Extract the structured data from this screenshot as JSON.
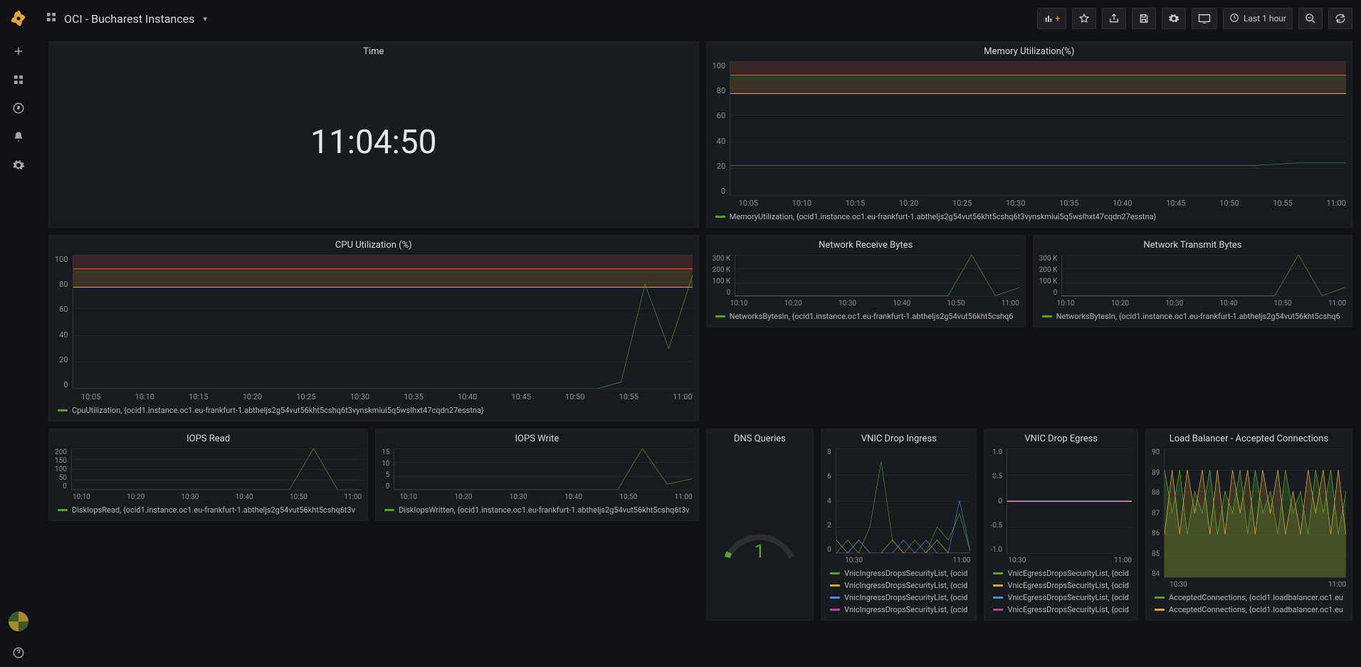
{
  "header": {
    "title": "OCI - Bucharest Instances",
    "time_range_label": "Last 1 hour"
  },
  "leftnav": {
    "items": [
      "create",
      "dashboards",
      "explore",
      "alerting",
      "configuration"
    ],
    "bottom": [
      "avatar",
      "help"
    ]
  },
  "topbar_icons": [
    "add-panel",
    "star",
    "share",
    "save",
    "settings",
    "cycle-view",
    "time-range",
    "zoom-out",
    "refresh"
  ],
  "panels": {
    "time": {
      "title": "Time",
      "value": "11:04:50"
    },
    "memory": {
      "title": "Memory Utilization(%)",
      "chart_data": {
        "type": "line",
        "ylim": [
          0,
          100
        ],
        "yticks": [
          0,
          20,
          40,
          60,
          80,
          100
        ],
        "xticks": [
          "10:05",
          "10:10",
          "10:15",
          "10:20",
          "10:25",
          "10:30",
          "10:35",
          "10:40",
          "10:45",
          "10:50",
          "10:55",
          "11:00"
        ],
        "thresholds": [
          {
            "value": 90,
            "color": "red",
            "fill_above": true
          },
          {
            "value": 76,
            "color": "orange",
            "fill_to_next": true
          }
        ],
        "series": [
          {
            "name": "MemoryUtilization, {ocid1.instance.oc1.eu-frankfurt-1.abtheljs2g54vut56kht5cshq6t3vynskmiui5q5wslhxt47cqdn27esstna}",
            "color": "#5aa02c",
            "values": [
              22,
              22,
              22,
              22,
              22,
              22,
              22,
              22,
              22,
              22,
              22,
              22,
              22,
              22,
              22,
              22,
              22,
              22,
              22,
              22,
              22,
              22,
              22,
              23,
              24,
              24,
              24
            ]
          }
        ]
      }
    },
    "cpu": {
      "title": "CPU Utilization (%)",
      "chart_data": {
        "type": "line",
        "ylim": [
          0,
          100
        ],
        "yticks": [
          0,
          20,
          40,
          60,
          80,
          100
        ],
        "xticks": [
          "10:05",
          "10:10",
          "10:15",
          "10:20",
          "10:25",
          "10:30",
          "10:35",
          "10:40",
          "10:45",
          "10:50",
          "10:55",
          "11:00"
        ],
        "thresholds": [
          {
            "value": 90,
            "color": "red",
            "fill_above": true
          },
          {
            "value": 76,
            "color": "orange",
            "fill_to_next": true
          }
        ],
        "series": [
          {
            "name": "CpuUtilization, {ocid1.instance.oc1.eu-frankfurt-1.abtheljs2g54vut56kht5cshq6t3vynskmiui5q5wslhxt47cqdn27esstna}",
            "color": "#5aa02c",
            "values": [
              0,
              0,
              0,
              0,
              0,
              0,
              0,
              0,
              0,
              0,
              0,
              0,
              0,
              0,
              0,
              0,
              0,
              0,
              0,
              0,
              0,
              0,
              0,
              5,
              78,
              30,
              85
            ]
          }
        ]
      }
    },
    "netrx": {
      "title": "Network Receive Bytes",
      "chart_data": {
        "type": "line",
        "ylim": [
          0,
          300000
        ],
        "yticks": [
          0,
          100000,
          200000,
          300000
        ],
        "ytick_labels": [
          "0",
          "100 K",
          "200 K",
          "300 K"
        ],
        "xticks": [
          "10:10",
          "10:20",
          "10:30",
          "10:40",
          "10:50",
          "11:00"
        ],
        "series": [
          {
            "name": "NetworksBytesIn, {ocid1.instance.oc1.eu-frankfurt-1.abtheljs2g54vut56kht5cshq6",
            "color": "#5aa02c",
            "values": [
              3000,
              3000,
              3000,
              3000,
              3000,
              3000,
              3000,
              3000,
              3000,
              3000,
              300000,
              3000,
              60000
            ]
          }
        ]
      }
    },
    "nettx": {
      "title": "Network Transmit Bytes",
      "chart_data": {
        "type": "line",
        "ylim": [
          0,
          300000
        ],
        "yticks": [
          0,
          100000,
          200000,
          300000
        ],
        "ytick_labels": [
          "0",
          "100 K",
          "200 K",
          "300 K"
        ],
        "xticks": [
          "10:10",
          "10:20",
          "10:30",
          "10:40",
          "10:50",
          "11:00"
        ],
        "series": [
          {
            "name": "NetworksBytesIn, {ocid1.instance.oc1.eu-frankfurt-1.abtheljs2g54vut56kht5cshq6",
            "color": "#5aa02c",
            "values": [
              3000,
              3000,
              3000,
              3000,
              3000,
              3000,
              3000,
              3000,
              3000,
              3000,
              300000,
              3000,
              65000
            ]
          }
        ]
      }
    },
    "iops_read": {
      "title": "IOPS Read",
      "chart_data": {
        "type": "line",
        "ylim": [
          0,
          200
        ],
        "yticks": [
          0,
          50,
          100,
          150,
          200
        ],
        "xticks": [
          "10:10",
          "10:20",
          "10:30",
          "10:40",
          "10:50",
          "11:00"
        ],
        "series": [
          {
            "name": "DiskIopsRead, {ocid1.instance.oc1.eu-frankfurt-1.abtheljs2g54vut56kht5cshq6t3v",
            "color": "#5aa02c",
            "values": [
              0,
              0,
              0,
              0,
              0,
              0,
              0,
              0,
              0,
              0,
              200,
              0,
              0
            ]
          }
        ]
      }
    },
    "iops_write": {
      "title": "IOPS Write",
      "chart_data": {
        "type": "line",
        "ylim": [
          0,
          15
        ],
        "yticks": [
          0,
          5,
          10,
          15
        ],
        "xticks": [
          "10:10",
          "10:20",
          "10:30",
          "10:40",
          "10:50",
          "11:00"
        ],
        "series": [
          {
            "name": "DiskIopsWritten, {ocid1.instance.oc1.eu-frankfurt-1.abtheljs2g54vut56kht5cshq6t3v",
            "color": "#5aa02c",
            "values": [
              0,
              0,
              0,
              0,
              0,
              0,
              0,
              0,
              0,
              0,
              15,
              2,
              4
            ]
          }
        ]
      }
    },
    "dns": {
      "title": "DNS Queries",
      "gauge": {
        "value": 1,
        "min": 0,
        "max": 100,
        "color": "#5aa02c"
      }
    },
    "vnic_in": {
      "title": "VNIC Drop Ingress",
      "chart_data": {
        "type": "line",
        "ylim": [
          0,
          8
        ],
        "yticks": [
          0,
          2,
          4,
          6,
          8
        ],
        "xticks": [
          "10:30",
          "11:00"
        ],
        "series": [
          {
            "name": "VnicIngressDropsSecurityList, {ocid",
            "color": "#5aa02c",
            "values": [
              0,
              1,
              0,
              2,
              7,
              1,
              0,
              1,
              0,
              2,
              1,
              3,
              0
            ]
          },
          {
            "name": "VnicIngressDropsSecurityList, {ocid",
            "color": "#d6a63c",
            "values": [
              1,
              0,
              1,
              0,
              0,
              1,
              0,
              0,
              0,
              1,
              0,
              0,
              0
            ]
          },
          {
            "name": "VnicIngressDropsSecurityList, {ocid",
            "color": "#4a90d9",
            "values": [
              0,
              0,
              1,
              0,
              0,
              0,
              1,
              0,
              1,
              0,
              0,
              4,
              0
            ]
          },
          {
            "name": "VnicIngressDropsSecurityList, {ocid",
            "color": "#b24a8e",
            "values": [
              0,
              0,
              0,
              0,
              0,
              0,
              0,
              0,
              0,
              0,
              0,
              0,
              0
            ]
          }
        ]
      }
    },
    "vnic_eg": {
      "title": "VNIC Drop Egress",
      "chart_data": {
        "type": "line",
        "ylim": [
          -1,
          1
        ],
        "yticks": [
          -1,
          -0.5,
          0,
          0.5,
          1
        ],
        "ytick_labels": [
          "-1.0",
          "-0.5",
          "0",
          "0.5",
          "1.0"
        ],
        "xticks": [
          "10:30",
          "11:00"
        ],
        "thresholds": [
          {
            "value": 0,
            "color": "orange",
            "fill_to_next": false
          }
        ],
        "series": [
          {
            "name": "VnicEgressDropsSecurityList, {ocid",
            "color": "#5aa02c",
            "values": [
              0,
              0,
              0,
              0,
              0,
              0,
              0,
              0,
              0,
              0,
              0,
              0,
              0
            ]
          },
          {
            "name": "VnicEgressDropsSecurityList, {ocid",
            "color": "#d6a63c",
            "values": [
              0,
              0,
              0,
              0,
              0,
              0,
              0,
              0,
              0,
              0,
              0,
              0,
              0
            ]
          },
          {
            "name": "VnicEgressDropsSecurityList, {ocid",
            "color": "#4a90d9",
            "values": [
              0,
              0,
              0,
              0,
              0,
              0,
              0,
              0,
              0,
              0,
              0,
              0,
              0
            ]
          },
          {
            "name": "VnicEgressDropsSecurityList, {ocid",
            "color": "#b24a8e",
            "values": [
              0,
              0,
              0,
              0,
              0,
              0,
              0,
              0,
              0,
              0,
              0,
              0,
              0
            ]
          }
        ]
      }
    },
    "lb": {
      "title": "Load Balancer - Accepted Connections",
      "chart_data": {
        "type": "line",
        "ylim": [
          84,
          90
        ],
        "yticks": [
          84,
          85,
          86,
          87,
          88,
          89,
          90
        ],
        "xticks": [
          "10:30",
          "11:00"
        ],
        "series": [
          {
            "name": "AcceptedConnections, {ocid1.loadbalancer.oc1.eu",
            "color": "#5aa02c",
            "values": [
              89,
              87,
              89,
              86,
              88,
              87,
              89,
              86,
              88,
              87,
              89,
              86,
              89,
              87,
              88,
              86,
              89,
              87,
              88,
              86,
              89,
              87,
              89,
              86,
              88
            ]
          },
          {
            "name": "AcceptedConnections, {ocid1.loadbalancer.oc1.eu",
            "color": "#d6a63c",
            "values": [
              86,
              89,
              86,
              89,
              87,
              89,
              86,
              89,
              86,
              89,
              87,
              89,
              86,
              89,
              87,
              89,
              86,
              88,
              86,
              89,
              87,
              89,
              86,
              89,
              86
            ]
          }
        ],
        "fill_below": [
          {
            "color": "rgba(90,160,44,0.25)"
          },
          {
            "color": "rgba(214,166,60,0.2)"
          }
        ]
      }
    }
  }
}
